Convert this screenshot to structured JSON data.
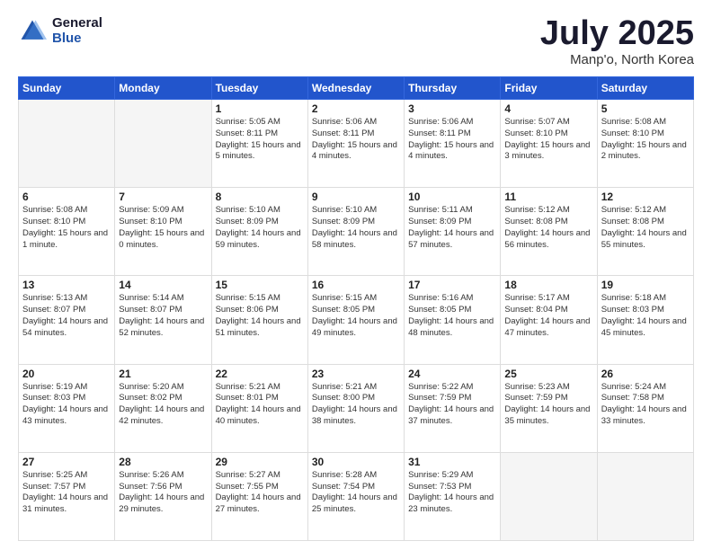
{
  "header": {
    "logo_general": "General",
    "logo_blue": "Blue",
    "month_title": "July 2025",
    "location": "Manp'o, North Korea"
  },
  "weekdays": [
    "Sunday",
    "Monday",
    "Tuesday",
    "Wednesday",
    "Thursday",
    "Friday",
    "Saturday"
  ],
  "weeks": [
    [
      {
        "day": "",
        "empty": true
      },
      {
        "day": "",
        "empty": true
      },
      {
        "day": "1",
        "sunrise": "Sunrise: 5:05 AM",
        "sunset": "Sunset: 8:11 PM",
        "daylight": "Daylight: 15 hours and 5 minutes."
      },
      {
        "day": "2",
        "sunrise": "Sunrise: 5:06 AM",
        "sunset": "Sunset: 8:11 PM",
        "daylight": "Daylight: 15 hours and 4 minutes."
      },
      {
        "day": "3",
        "sunrise": "Sunrise: 5:06 AM",
        "sunset": "Sunset: 8:11 PM",
        "daylight": "Daylight: 15 hours and 4 minutes."
      },
      {
        "day": "4",
        "sunrise": "Sunrise: 5:07 AM",
        "sunset": "Sunset: 8:10 PM",
        "daylight": "Daylight: 15 hours and 3 minutes."
      },
      {
        "day": "5",
        "sunrise": "Sunrise: 5:08 AM",
        "sunset": "Sunset: 8:10 PM",
        "daylight": "Daylight: 15 hours and 2 minutes."
      }
    ],
    [
      {
        "day": "6",
        "sunrise": "Sunrise: 5:08 AM",
        "sunset": "Sunset: 8:10 PM",
        "daylight": "Daylight: 15 hours and 1 minute."
      },
      {
        "day": "7",
        "sunrise": "Sunrise: 5:09 AM",
        "sunset": "Sunset: 8:10 PM",
        "daylight": "Daylight: 15 hours and 0 minutes."
      },
      {
        "day": "8",
        "sunrise": "Sunrise: 5:10 AM",
        "sunset": "Sunset: 8:09 PM",
        "daylight": "Daylight: 14 hours and 59 minutes."
      },
      {
        "day": "9",
        "sunrise": "Sunrise: 5:10 AM",
        "sunset": "Sunset: 8:09 PM",
        "daylight": "Daylight: 14 hours and 58 minutes."
      },
      {
        "day": "10",
        "sunrise": "Sunrise: 5:11 AM",
        "sunset": "Sunset: 8:09 PM",
        "daylight": "Daylight: 14 hours and 57 minutes."
      },
      {
        "day": "11",
        "sunrise": "Sunrise: 5:12 AM",
        "sunset": "Sunset: 8:08 PM",
        "daylight": "Daylight: 14 hours and 56 minutes."
      },
      {
        "day": "12",
        "sunrise": "Sunrise: 5:12 AM",
        "sunset": "Sunset: 8:08 PM",
        "daylight": "Daylight: 14 hours and 55 minutes."
      }
    ],
    [
      {
        "day": "13",
        "sunrise": "Sunrise: 5:13 AM",
        "sunset": "Sunset: 8:07 PM",
        "daylight": "Daylight: 14 hours and 54 minutes."
      },
      {
        "day": "14",
        "sunrise": "Sunrise: 5:14 AM",
        "sunset": "Sunset: 8:07 PM",
        "daylight": "Daylight: 14 hours and 52 minutes."
      },
      {
        "day": "15",
        "sunrise": "Sunrise: 5:15 AM",
        "sunset": "Sunset: 8:06 PM",
        "daylight": "Daylight: 14 hours and 51 minutes."
      },
      {
        "day": "16",
        "sunrise": "Sunrise: 5:15 AM",
        "sunset": "Sunset: 8:05 PM",
        "daylight": "Daylight: 14 hours and 49 minutes."
      },
      {
        "day": "17",
        "sunrise": "Sunrise: 5:16 AM",
        "sunset": "Sunset: 8:05 PM",
        "daylight": "Daylight: 14 hours and 48 minutes."
      },
      {
        "day": "18",
        "sunrise": "Sunrise: 5:17 AM",
        "sunset": "Sunset: 8:04 PM",
        "daylight": "Daylight: 14 hours and 47 minutes."
      },
      {
        "day": "19",
        "sunrise": "Sunrise: 5:18 AM",
        "sunset": "Sunset: 8:03 PM",
        "daylight": "Daylight: 14 hours and 45 minutes."
      }
    ],
    [
      {
        "day": "20",
        "sunrise": "Sunrise: 5:19 AM",
        "sunset": "Sunset: 8:03 PM",
        "daylight": "Daylight: 14 hours and 43 minutes."
      },
      {
        "day": "21",
        "sunrise": "Sunrise: 5:20 AM",
        "sunset": "Sunset: 8:02 PM",
        "daylight": "Daylight: 14 hours and 42 minutes."
      },
      {
        "day": "22",
        "sunrise": "Sunrise: 5:21 AM",
        "sunset": "Sunset: 8:01 PM",
        "daylight": "Daylight: 14 hours and 40 minutes."
      },
      {
        "day": "23",
        "sunrise": "Sunrise: 5:21 AM",
        "sunset": "Sunset: 8:00 PM",
        "daylight": "Daylight: 14 hours and 38 minutes."
      },
      {
        "day": "24",
        "sunrise": "Sunrise: 5:22 AM",
        "sunset": "Sunset: 7:59 PM",
        "daylight": "Daylight: 14 hours and 37 minutes."
      },
      {
        "day": "25",
        "sunrise": "Sunrise: 5:23 AM",
        "sunset": "Sunset: 7:59 PM",
        "daylight": "Daylight: 14 hours and 35 minutes."
      },
      {
        "day": "26",
        "sunrise": "Sunrise: 5:24 AM",
        "sunset": "Sunset: 7:58 PM",
        "daylight": "Daylight: 14 hours and 33 minutes."
      }
    ],
    [
      {
        "day": "27",
        "sunrise": "Sunrise: 5:25 AM",
        "sunset": "Sunset: 7:57 PM",
        "daylight": "Daylight: 14 hours and 31 minutes."
      },
      {
        "day": "28",
        "sunrise": "Sunrise: 5:26 AM",
        "sunset": "Sunset: 7:56 PM",
        "daylight": "Daylight: 14 hours and 29 minutes."
      },
      {
        "day": "29",
        "sunrise": "Sunrise: 5:27 AM",
        "sunset": "Sunset: 7:55 PM",
        "daylight": "Daylight: 14 hours and 27 minutes."
      },
      {
        "day": "30",
        "sunrise": "Sunrise: 5:28 AM",
        "sunset": "Sunset: 7:54 PM",
        "daylight": "Daylight: 14 hours and 25 minutes."
      },
      {
        "day": "31",
        "sunrise": "Sunrise: 5:29 AM",
        "sunset": "Sunset: 7:53 PM",
        "daylight": "Daylight: 14 hours and 23 minutes."
      },
      {
        "day": "",
        "empty": true
      },
      {
        "day": "",
        "empty": true
      }
    ]
  ]
}
